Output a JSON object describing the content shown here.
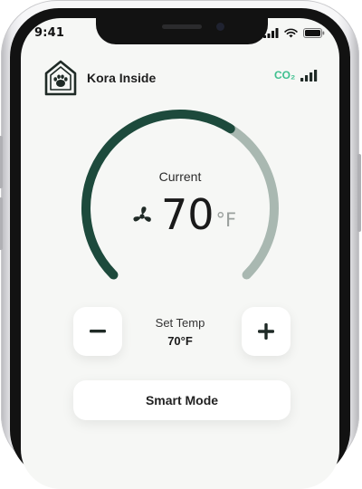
{
  "status_bar": {
    "time": "9:41",
    "icons": [
      "cellular-signal-icon",
      "wifi-icon",
      "battery-icon"
    ]
  },
  "header": {
    "brand_name": "Kora Inside",
    "logo_icon": "house-paw-icon",
    "co2_label": "CO₂",
    "co2_signal_icon": "signal-bars-icon"
  },
  "thermostat": {
    "current_label": "Current",
    "current_temp": "70",
    "unit": "°F",
    "fan_icon": "fan-icon",
    "gauge_level": 0.62,
    "colors": {
      "gauge_active": "#1d4a3c",
      "gauge_inactive": "#a9b8b1",
      "accent": "#3fc08f"
    }
  },
  "controls": {
    "decrease_icon": "minus-icon",
    "increase_icon": "plus-icon",
    "set_temp_label": "Set Temp",
    "set_temp_value": "70°F",
    "smart_mode_label": "Smart Mode"
  }
}
